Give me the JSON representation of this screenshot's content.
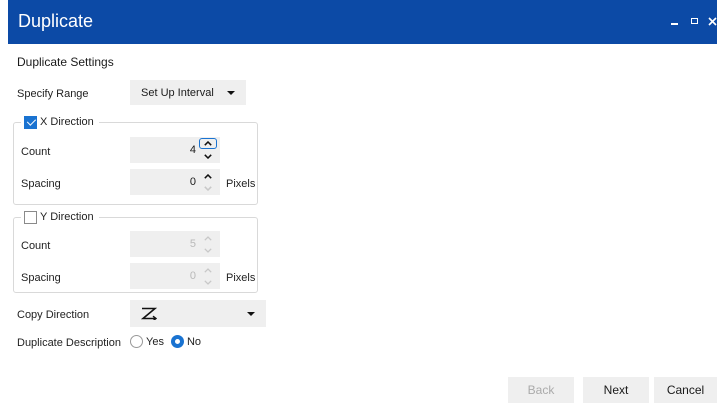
{
  "window": {
    "title": "Duplicate"
  },
  "settings": {
    "heading": "Duplicate Settings",
    "specify_range": {
      "label": "Specify Range",
      "value": "Set Up Interval"
    },
    "x_direction": {
      "label": "X Direction",
      "checked": true,
      "count": {
        "label": "Count",
        "value": "4"
      },
      "spacing": {
        "label": "Spacing",
        "value": "0",
        "unit": "Pixels"
      }
    },
    "y_direction": {
      "label": "Y Direction",
      "checked": false,
      "count": {
        "label": "Count",
        "value": "5"
      },
      "spacing": {
        "label": "Spacing",
        "value": "0",
        "unit": "Pixels"
      }
    },
    "copy_direction": {
      "label": "Copy Direction",
      "value": "Z"
    },
    "duplicate_description": {
      "label": "Duplicate Description",
      "options": [
        "Yes",
        "No"
      ],
      "selected": "No"
    }
  },
  "buttons": {
    "back": "Back",
    "next": "Next",
    "cancel": "Cancel"
  },
  "colors": {
    "titlebar": "#0c4aa6",
    "accent": "#1a73d1",
    "field": "#efefef"
  }
}
